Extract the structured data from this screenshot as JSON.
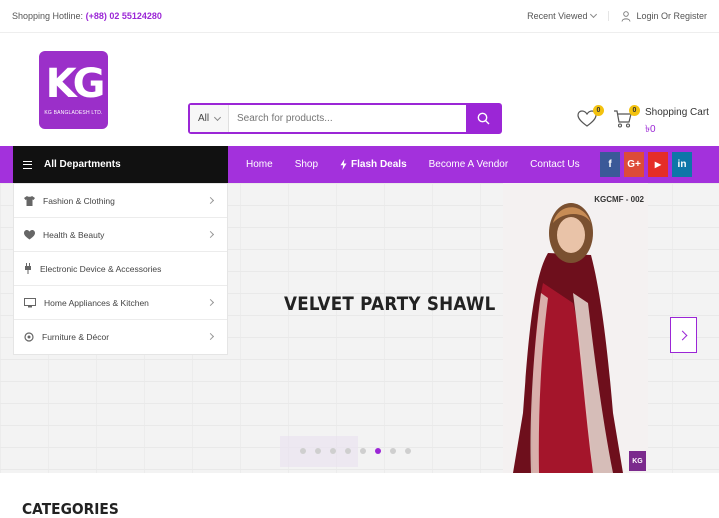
{
  "topbar": {
    "hotline_label": "Shopping Hotline:",
    "hotline_number": "(+88) 02 55124280",
    "recent_viewed": "Recent Viewed",
    "login": "Login Or Register"
  },
  "logo": {
    "mark": "KG",
    "text": "KG BANGLADESH LTD."
  },
  "search": {
    "category": "All",
    "placeholder": "Search for products..."
  },
  "header": {
    "wishlist_count": "0",
    "cart_count": "0",
    "cart_label": "Shopping Cart",
    "cart_amount": "৳0"
  },
  "nav": {
    "departments_label": "All Departments",
    "items": [
      "Home",
      "Shop",
      "Flash Deals",
      "Become A Vendor",
      "Contact Us"
    ],
    "socials": [
      {
        "name": "facebook-icon",
        "glyph": "f",
        "color": "#3b5998"
      },
      {
        "name": "google-plus-icon",
        "glyph": "G+",
        "color": "#dd4b39"
      },
      {
        "name": "youtube-icon",
        "glyph": "▶",
        "color": "#e52d27"
      },
      {
        "name": "linkedin-icon",
        "glyph": "in",
        "color": "#0e76a8"
      }
    ]
  },
  "sidebar": {
    "items": [
      {
        "label": "Fashion & Clothing",
        "icon": "shirt-icon"
      },
      {
        "label": "Health & Beauty",
        "icon": "heart-pulse-icon"
      },
      {
        "label": "Electronic Device & Accessories",
        "icon": "plug-icon"
      },
      {
        "label": "Home Appliances & Kitchen",
        "icon": "monitor-icon"
      },
      {
        "label": "Furniture & Décor",
        "icon": "lamp-icon"
      }
    ]
  },
  "hero": {
    "title": "VELVET PARTY SHAWL",
    "product_code": "KGCMF - 002",
    "watermark": "KG",
    "slide_count": 8,
    "active_slide": 6
  },
  "section": {
    "categories_title": "CATEGORIES"
  },
  "colors": {
    "brand": "#9b26d6",
    "nav_bg": "#a331dc",
    "dept_bg": "#111111",
    "badge": "#f3c20f"
  }
}
